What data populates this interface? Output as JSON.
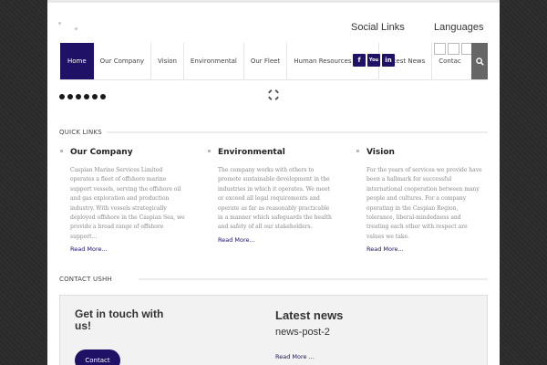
{
  "header": {
    "social_heading": "Social Links",
    "languages_heading": "Languages"
  },
  "nav": {
    "items": [
      "Home",
      "Our Company",
      "Vision",
      "Environmental",
      "Our Fleet",
      "Human Resources",
      "Latest News",
      "Contac"
    ],
    "active": "Home"
  },
  "social": {
    "facebook": "f",
    "youtube": "You",
    "linkedin": "in"
  },
  "icons": {
    "search": "search-icon",
    "spinner": "loading-spinner-icon"
  },
  "quick_links": {
    "label": "QUICK LINKS",
    "columns": [
      {
        "title": "Our Company",
        "lines": [
          "Caspian Marine Services Limited",
          "operates a fleet of offshore marine",
          "support vessels, serving the offshore oil",
          "and gas exploration and production",
          "industry. With vessels strategically",
          "deployed offshore in the Caspian Sea, we",
          "provide a broad range of offshore",
          "support..."
        ],
        "link": "Read More..."
      },
      {
        "title": "Environmental",
        "lines": [
          "The company works with others to",
          "promote sustainable development in the",
          "industries in which it operates. We meet",
          "or exceed all legal requirements and",
          "operate as far as reasonably practicable",
          "in a manner which safeguards the health",
          "and safety of all our stakeholders."
        ],
        "link": "Read More..."
      },
      {
        "title": "Vision",
        "lines": [
          "For the years of services we provide have",
          "been a hallmark for successful",
          "international cooperation between many",
          "people and cultures. For a company",
          "operating in the Caspian Region,",
          "tolerance, liberal-mindedness and",
          "treating each other with respect are",
          "values we take."
        ],
        "link": "Read More..."
      }
    ]
  },
  "contact": {
    "label": "CONTACT USHH",
    "heading": "Get in touch with us!",
    "button": "Contact",
    "news_heading": "Latest news",
    "news_post": "news-post-2",
    "news_link": "Read More ..."
  },
  "colors": {
    "accent": "#1f1166",
    "background": "#2a2a2a",
    "page": "#ffffff"
  }
}
